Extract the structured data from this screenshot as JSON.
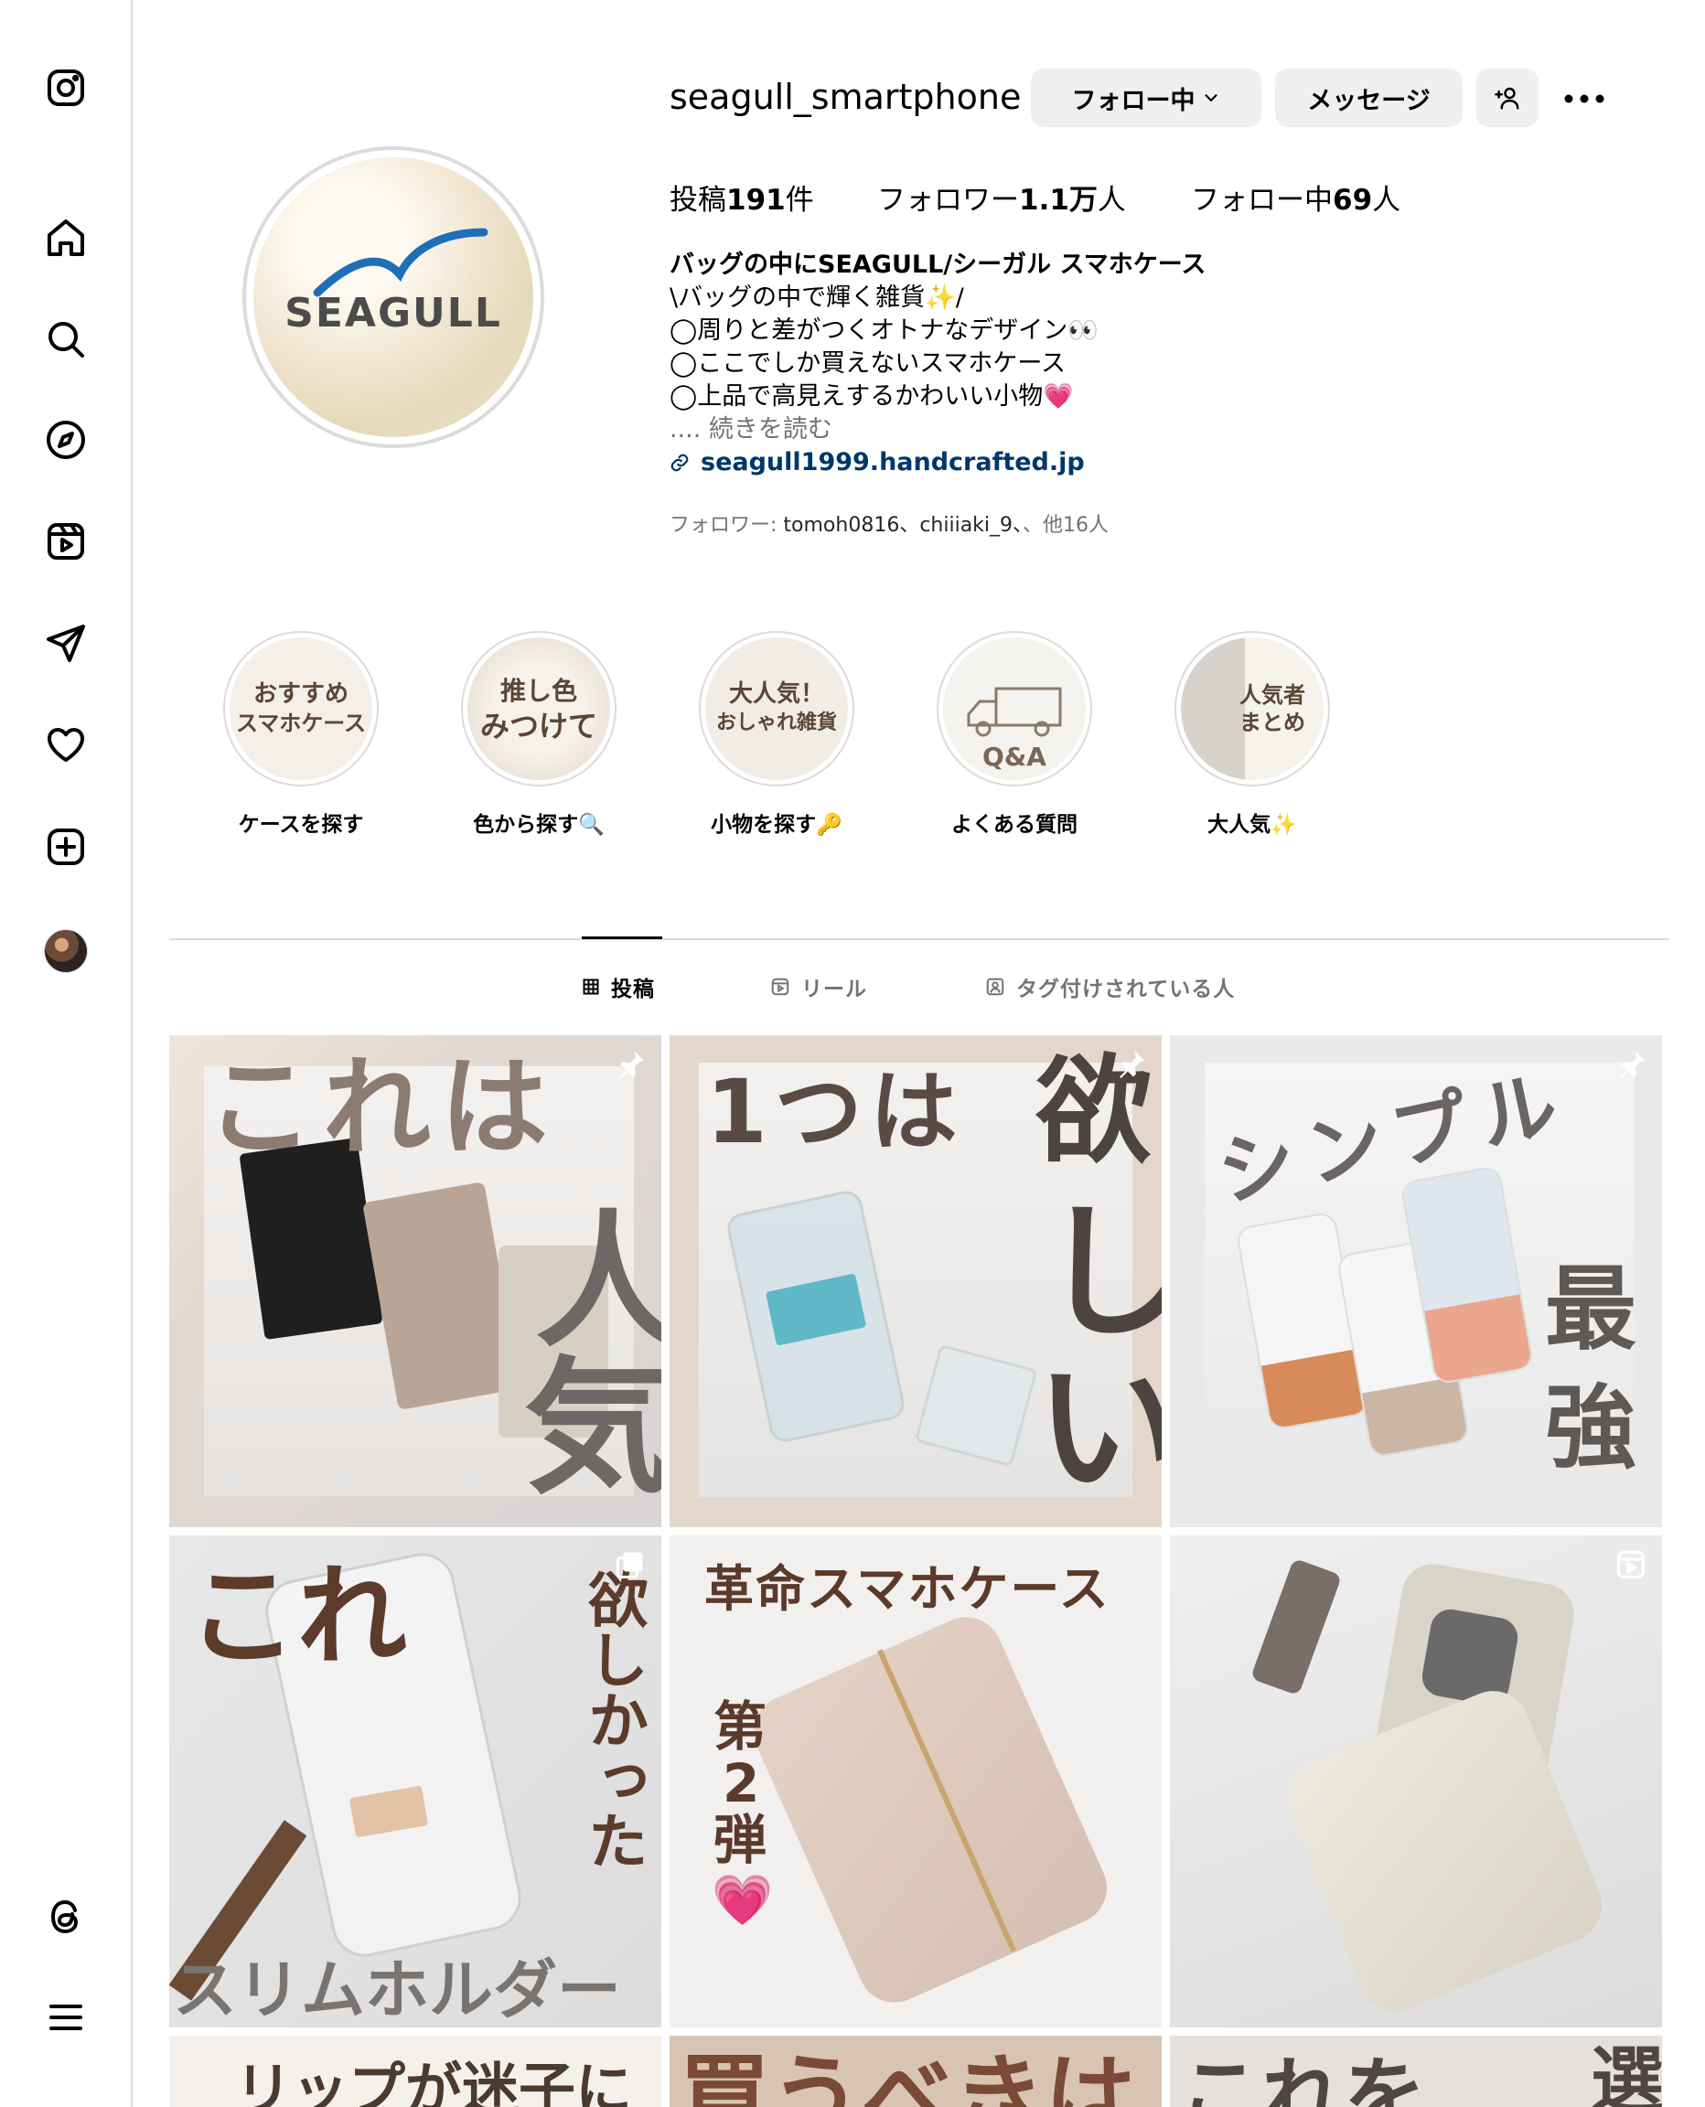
{
  "profile": {
    "username": "seagull_smartphone",
    "logo_text": "SEAGULL",
    "buttons": {
      "follow": "フォロー中",
      "message": "メッセージ"
    },
    "stats": [
      {
        "label": "投稿",
        "value": "191",
        "suffix": "件"
      },
      {
        "label": "フォロワー",
        "value": "1.1万",
        "suffix": "人"
      },
      {
        "label": "フォロー中",
        "value": "69",
        "suffix": "人"
      }
    ],
    "bio": {
      "name": "バッグの中にSEAGULL/シーガル スマホケース",
      "lines": [
        "\\バッグの中で輝く雑貨✨/",
        "◯周りと差がつくオトナなデザイン👀",
        "◯ここでしか買えないスマホケース",
        "◯上品で高見えするかわいい小物💗"
      ],
      "more": ".... 続きを読む",
      "link": "seagull1999.handcrafted.jp"
    },
    "followed_by": {
      "prefix": "フォロワー: ",
      "names": "tomoh0816、chiiiaki_9、",
      "suffix": "、他16人"
    }
  },
  "highlights": [
    {
      "label": "ケースを探す",
      "cover": [
        "おすすめ",
        "スマホケース"
      ]
    },
    {
      "label": "色から探す🔍",
      "cover": [
        "推し色",
        "みつけて"
      ]
    },
    {
      "label": "小物を探す🔑",
      "cover": [
        "大人気！",
        "おしゃれ雑貨"
      ]
    },
    {
      "label": "よくある質問",
      "cover": [
        "Q&A"
      ]
    },
    {
      "label": "大人気✨",
      "cover": [
        "人気者",
        "まとめ"
      ]
    }
  ],
  "tabs": [
    {
      "label": "投稿",
      "active": true
    },
    {
      "label": "リール",
      "active": false
    },
    {
      "label": "タグ付けされている人",
      "active": false
    }
  ],
  "posts": [
    {
      "texts": [
        "これは",
        "人",
        "気"
      ],
      "pinned": true
    },
    {
      "texts": [
        "1つは",
        "欲",
        "し",
        "い"
      ],
      "pinned": true
    },
    {
      "texts": [
        "シンプル",
        "最",
        "強"
      ],
      "pinned": true
    },
    {
      "texts": [
        "これ",
        "欲しかった",
        "スリムホルダー"
      ],
      "type": "carousel"
    },
    {
      "texts": [
        "革命スマホケース",
        "第",
        "2",
        "弾",
        "💗"
      ]
    },
    {
      "texts": [],
      "type": "reel"
    },
    {
      "texts": [
        "リップが迷子に"
      ]
    },
    {
      "texts": [
        "買うべきは"
      ]
    },
    {
      "texts": [
        "これを",
        "選"
      ]
    }
  ]
}
